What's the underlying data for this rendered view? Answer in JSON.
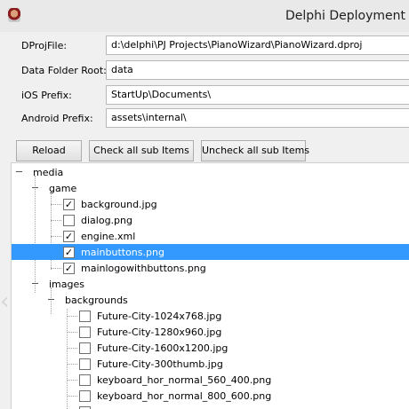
{
  "window": {
    "title": "Delphi Deployment"
  },
  "form": {
    "dproj_label": "DProjFile:",
    "dproj_value": "d:\\delphi\\PJ Projects\\PianoWizard\\PianoWizard.dproj",
    "data_label": "Data Folder Root:",
    "data_value": "data",
    "ios_label": "iOS Prefix:",
    "ios_value": "StartUp\\Documents\\",
    "android_label": "Android Prefix:",
    "android_value": "assets\\internal\\"
  },
  "toolbar": {
    "reload_label": "Reload",
    "check_all_label": "Check all sub Items",
    "uncheck_all_label": "Uncheck all sub Items"
  },
  "tree": {
    "media": "media",
    "game": "game",
    "background_jpg": "background.jpg",
    "dialog_png": "dialog.png",
    "engine_xml": "engine.xml",
    "mainbuttons_png": "mainbuttons.png",
    "mainlogowithbuttons_png": "mainlogowithbuttons.png",
    "images": "images",
    "backgrounds": "backgrounds",
    "future_1024": "Future-City-1024x768.jpg",
    "future_1280": "Future-City-1280x960.jpg",
    "future_1600": "Future-City-1600x1200.jpg",
    "future_300": "Future-City-300thumb.jpg",
    "keyboard_560": "keyboard_hor_normal_560_400.png",
    "keyboard_800": "keyboard_hor_normal_800_600.png"
  },
  "icons": {
    "check_glyph": "✓",
    "expanded_glyph": "−",
    "chevron_glyph": "‹"
  },
  "colors": {
    "selection": "#3399ff"
  }
}
